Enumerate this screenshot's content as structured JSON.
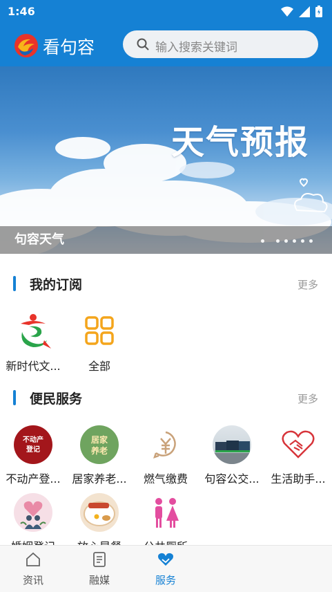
{
  "status_bar": {
    "time": "1:46"
  },
  "header": {
    "app_name": "看句容",
    "search_placeholder": "输入搜索关键词"
  },
  "banner": {
    "headline": "天气预报",
    "caption": "句容天气",
    "page_count": 6,
    "active_page": 1
  },
  "subscriptions": {
    "title": "我的订阅",
    "more": "更多",
    "items": [
      {
        "label": "新时代文...",
        "icon": "new-era-logo-icon"
      },
      {
        "label": "全部",
        "icon": "grid-icon"
      }
    ]
  },
  "services": {
    "title": "便民服务",
    "more": "更多",
    "items": [
      {
        "label": "不动产登...",
        "icon_text": "不动产\n登记",
        "icon": "real-estate-icon"
      },
      {
        "label": "居家养老...",
        "icon_text": "居家\n养老",
        "icon": "elderly-care-icon"
      },
      {
        "label": "燃气缴费",
        "icon": "yuan-payment-icon"
      },
      {
        "label": "句容公交...",
        "icon": "bus-photo-icon"
      },
      {
        "label": "生活助手...",
        "icon": "handshake-heart-icon"
      },
      {
        "label": "婚姻登记",
        "icon": "wedding-icon"
      },
      {
        "label": "放心早餐",
        "icon": "breakfast-icon"
      },
      {
        "label": "公共厕所",
        "icon": "restroom-icon"
      }
    ]
  },
  "bottom_nav": {
    "items": [
      {
        "label": "资讯",
        "icon": "home-icon"
      },
      {
        "label": "融媒",
        "icon": "document-icon"
      },
      {
        "label": "服务",
        "icon": "heart-hands-icon"
      }
    ],
    "active": "服务"
  },
  "colors": {
    "primary": "#1581d4",
    "muted": "#999999"
  }
}
